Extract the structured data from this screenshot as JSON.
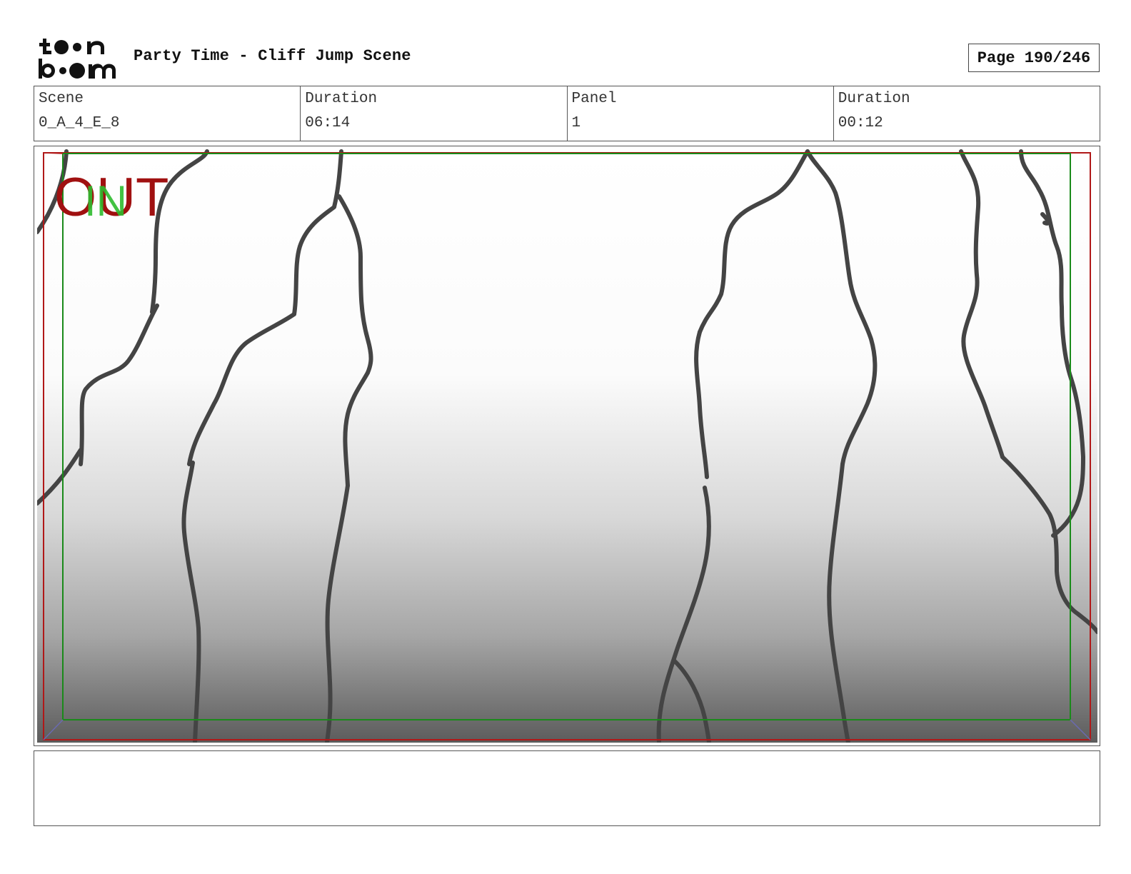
{
  "header": {
    "logo_text": "toon boom",
    "title": "Party Time - Cliff Jump Scene",
    "page_label": "Page 190/246"
  },
  "info": {
    "scene_label": "Scene",
    "scene_value": "0_A_4_E_8",
    "scene_duration_label": "Duration",
    "scene_duration_value": "06:14",
    "panel_label": "Panel",
    "panel_value": "1",
    "panel_duration_label": "Duration",
    "panel_duration_value": "00:12"
  },
  "panel": {
    "in_marker": "IN",
    "out_marker": "OUT",
    "colors": {
      "line": "#444444",
      "safe_frame": "#1a8a1a",
      "camera_frame": "#b01818",
      "in_text": "#2dbb2d",
      "out_text": "#a01010"
    }
  },
  "notes": {
    "text": ""
  }
}
